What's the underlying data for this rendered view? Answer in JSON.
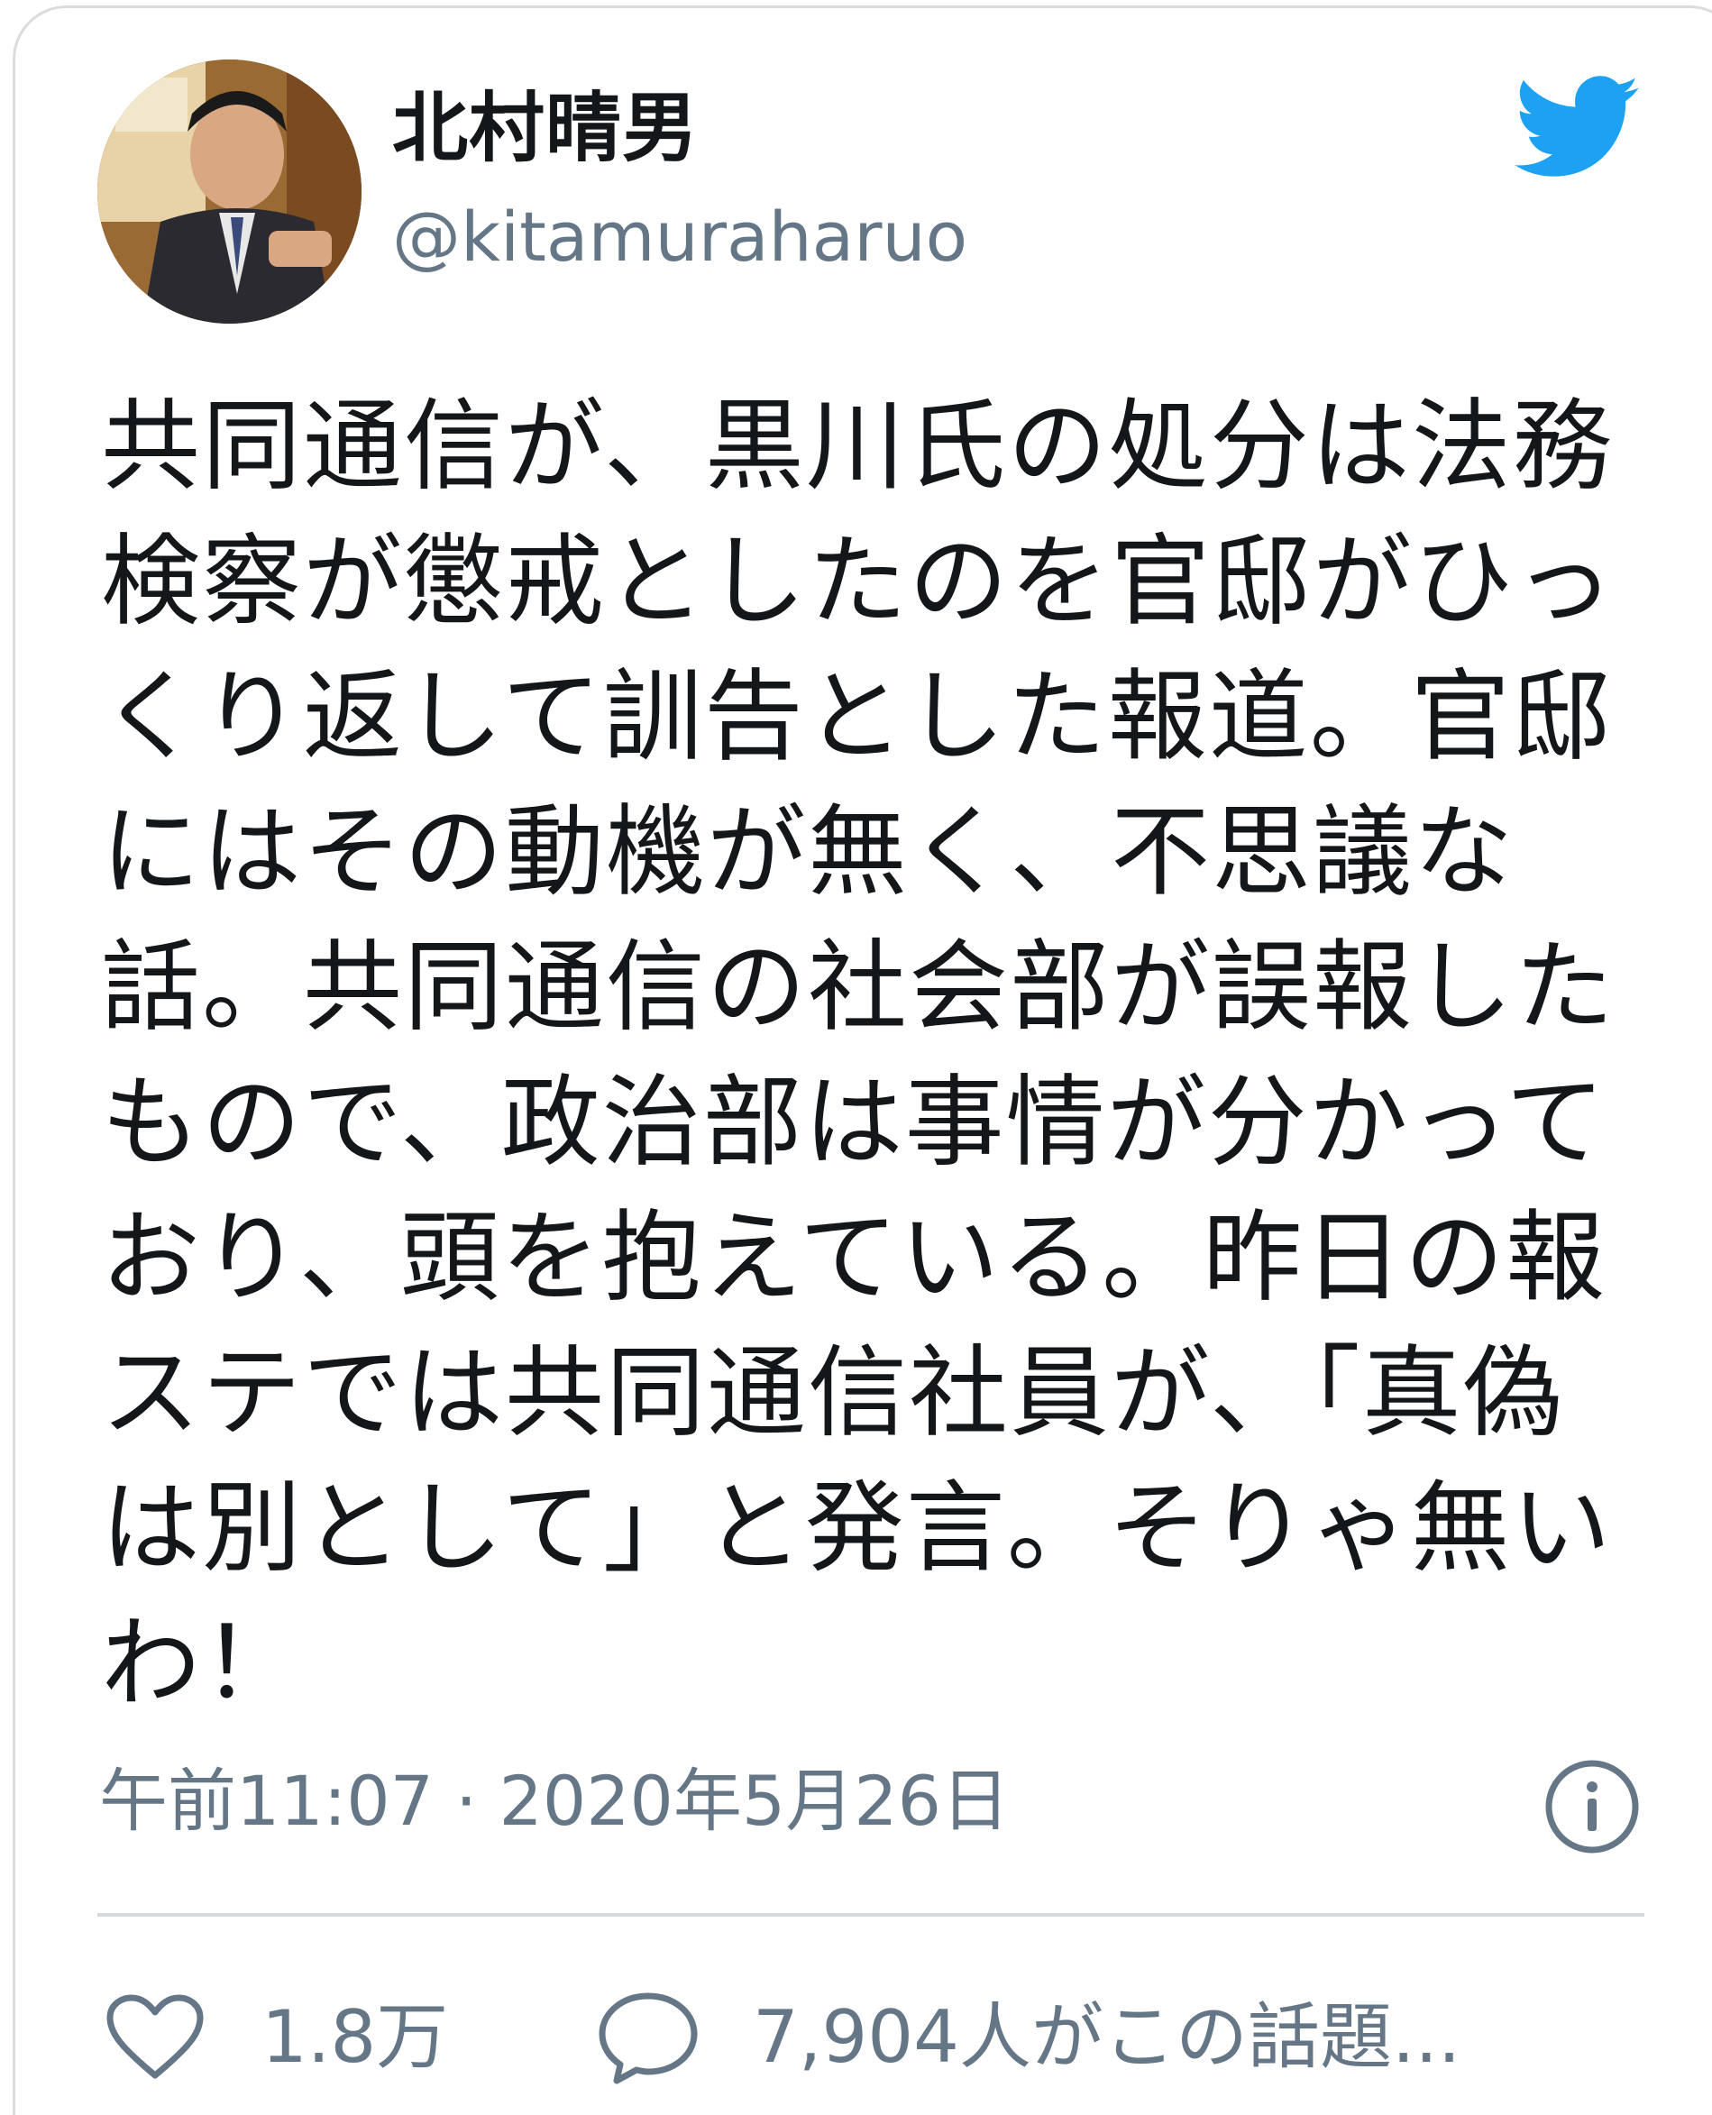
{
  "author": {
    "display_name": "北村晴男",
    "handle": "@kitamuraharuo"
  },
  "tweet": {
    "lines": [
      "共同通信が、黒川氏の処分は法務",
      "検察が懲戒としたのを官邸がひっ",
      "くり返して訓告とした報道。官邸",
      "にはその動機が無く、不思議な",
      "話。共同通信の社会部が誤報した",
      "もので、政治部は事情が分かって",
      "おり、頭を抱えている。昨日の報",
      "ステでは共同通信社員が、「真偽",
      "は別として」と発言。そりゃ無い",
      "わ！"
    ],
    "timestamp": "午前11:07 · 2020年5月26日"
  },
  "stats": {
    "likes": "1.8万",
    "talking": "7,904人がこの話題..."
  },
  "colors": {
    "twitter_blue": "#1da1f2",
    "secondary_text": "#657786",
    "primary_text": "#14171a"
  },
  "icons": {
    "logo": "twitter-bird-icon",
    "info": "info-icon",
    "like": "heart-icon",
    "reply": "speech-bubble-icon"
  }
}
